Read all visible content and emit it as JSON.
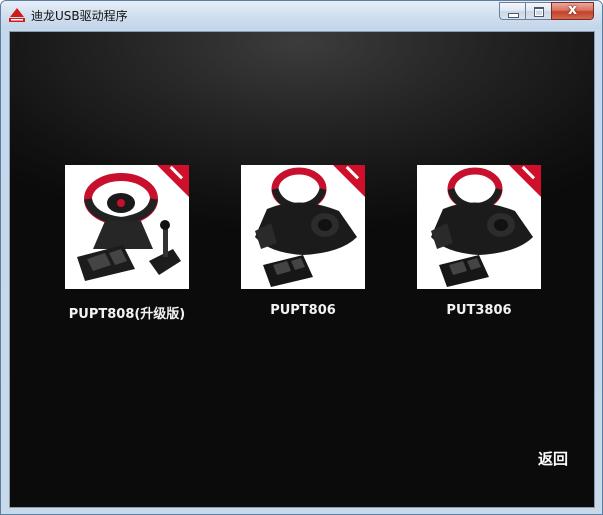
{
  "window": {
    "title": "迪龙USB驱动程序",
    "close_label": "x"
  },
  "products": [
    {
      "label": "PUPT808(升级版)",
      "icon": "steering-wheel-with-gear-shifter-image"
    },
    {
      "label": "PUPT806",
      "icon": "steering-wheel-with-pedals-image"
    },
    {
      "label": "PUT3806",
      "icon": "steering-wheel-with-pedals-image"
    }
  ],
  "back_label": "返回",
  "colors": {
    "background": "#0b0b0b",
    "accent_red": "#c8102e",
    "text": "#ffffff"
  }
}
